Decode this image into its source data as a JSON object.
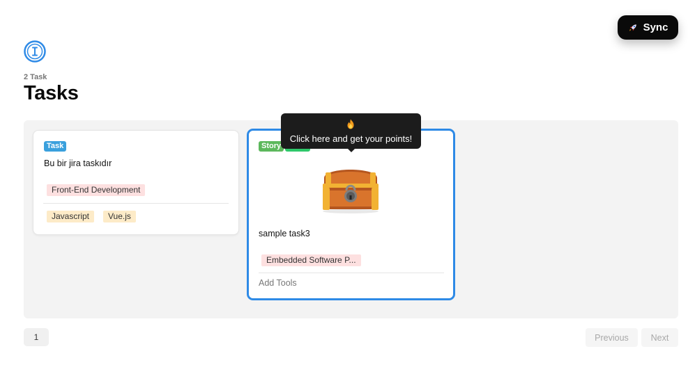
{
  "header": {
    "sync_label": "Sync",
    "sync_icon": "rocket-icon",
    "logo_icon": "info-circle-icon",
    "count_label": "2 Task",
    "title": "Tasks"
  },
  "cards": [
    {
      "type": "Task",
      "title": "Bu bir jira taskıdır",
      "category_tag": "Front-End Development",
      "tech_tags": [
        "Javascript",
        "Vue.js"
      ]
    },
    {
      "type": "Story",
      "title": "sample task3",
      "category_tag": "Embedded Software P...",
      "add_tools_label": "Add Tools",
      "image": "treasure-chest-icon"
    }
  ],
  "tooltip": {
    "icon": "fire-icon",
    "text": "Click here and get your points!"
  },
  "pagination": {
    "current_page": "1",
    "previous_label": "Previous",
    "next_label": "Next"
  },
  "colors": {
    "accent_blue": "#2e8ae6",
    "task_badge": "#3aa0dd",
    "story_badge": "#5cb85c",
    "tag_red_bg": "#fde0e0",
    "tag_yellow_bg": "#fdebc8"
  }
}
